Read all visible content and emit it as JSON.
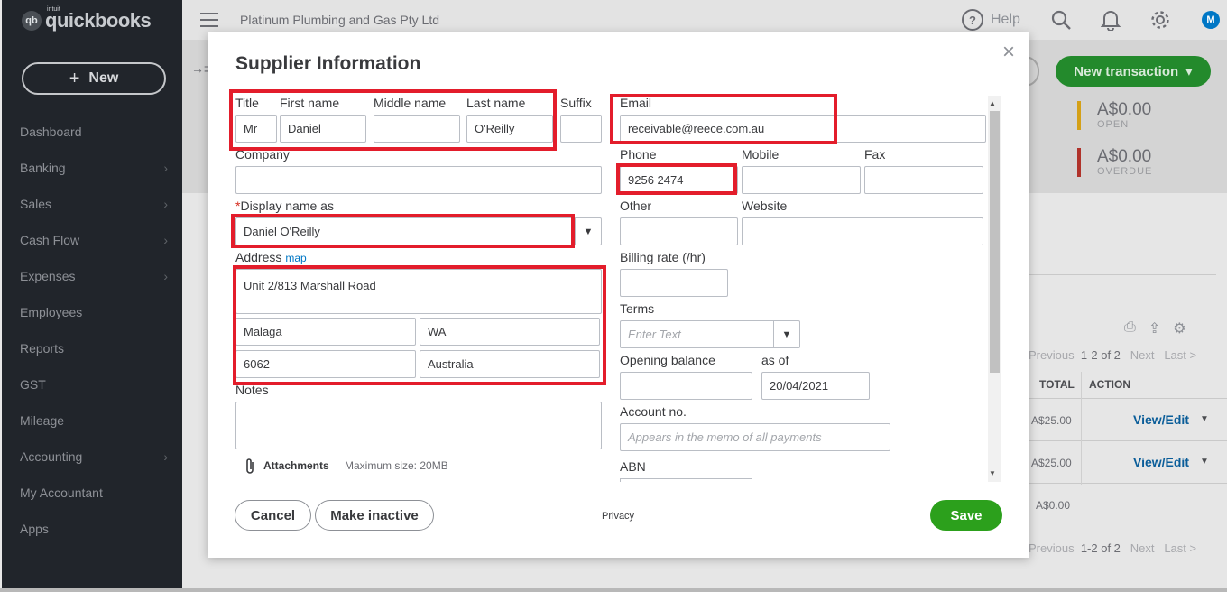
{
  "app": {
    "logo_badge": "qb",
    "logo_brand": "intuit",
    "logo_name": "quickbooks",
    "new_label": "New",
    "new_plus": "+",
    "company": "Platinum Plumbing and Gas Pty Ltd",
    "help_label": "Help",
    "avatar_letter": "M"
  },
  "nav": [
    {
      "label": "Dashboard",
      "chevron": ""
    },
    {
      "label": "Banking",
      "chevron": "›"
    },
    {
      "label": "Sales",
      "chevron": "›"
    },
    {
      "label": "Cash Flow",
      "chevron": "›"
    },
    {
      "label": "Expenses",
      "chevron": "›"
    },
    {
      "label": "Employees",
      "chevron": ""
    },
    {
      "label": "Reports",
      "chevron": ""
    },
    {
      "label": "GST",
      "chevron": ""
    },
    {
      "label": "Mileage",
      "chevron": ""
    },
    {
      "label": "Accounting",
      "chevron": "›"
    },
    {
      "label": "My Accountant",
      "chevron": ""
    },
    {
      "label": "Apps",
      "chevron": ""
    }
  ],
  "background": {
    "new_transaction": "New transaction",
    "open_amount": "A$0.00",
    "open_label": "OPEN",
    "overdue_amount": "A$0.00",
    "overdue_label": "OVERDUE",
    "open_color": "#d4a017",
    "overdue_color": "#b0322a",
    "pager_prev": "Previous",
    "pager_range": "1-2 of 2",
    "pager_next": "Next",
    "pager_last": "Last >",
    "col_total": "TOTAL",
    "col_action": "ACTION",
    "rows": [
      {
        "total": "A$25.00",
        "action": "View/Edit"
      },
      {
        "total": "A$25.00",
        "action": "View/Edit"
      },
      {
        "total": "A$0.00",
        "action": ""
      }
    ]
  },
  "modal": {
    "title": "Supplier Information",
    "close": "×",
    "labels": {
      "title": "Title",
      "first_name": "First name",
      "middle_name": "Middle name",
      "last_name": "Last name",
      "suffix": "Suffix",
      "email": "Email",
      "company": "Company",
      "phone": "Phone",
      "mobile": "Mobile",
      "fax": "Fax",
      "display_name": "Display name as",
      "display_required": "*",
      "other": "Other",
      "website": "Website",
      "address": "Address",
      "map": "map",
      "billing_rate": "Billing rate (/hr)",
      "terms": "Terms",
      "opening_balance": "Opening balance",
      "as_of": "as of",
      "notes": "Notes",
      "account_no": "Account no.",
      "abn": "ABN"
    },
    "values": {
      "title": "Mr",
      "first_name": "Daniel",
      "middle_name": "",
      "last_name": "O'Reilly",
      "suffix": "",
      "email": "receivable@reece.com.au",
      "company": "",
      "phone": "9256 2474",
      "mobile": "",
      "fax": "",
      "display_name": "Daniel O'Reilly",
      "other": "",
      "website": "",
      "street": "Unit 2/813 Marshall Road",
      "city": "Malaga",
      "state": "WA",
      "postcode": "6062",
      "country": "Australia",
      "billing_rate": "",
      "opening_balance": "",
      "as_of_date": "20/04/2021",
      "notes": ""
    },
    "placeholders": {
      "terms": "Enter Text",
      "account_no": "Appears in the memo of all payments"
    },
    "attachments_label": "Attachments",
    "attachments_max": "Maximum size: 20MB",
    "cancel": "Cancel",
    "make_inactive": "Make inactive",
    "privacy": "Privacy",
    "save": "Save",
    "highlight_color": "#e31d2b"
  }
}
